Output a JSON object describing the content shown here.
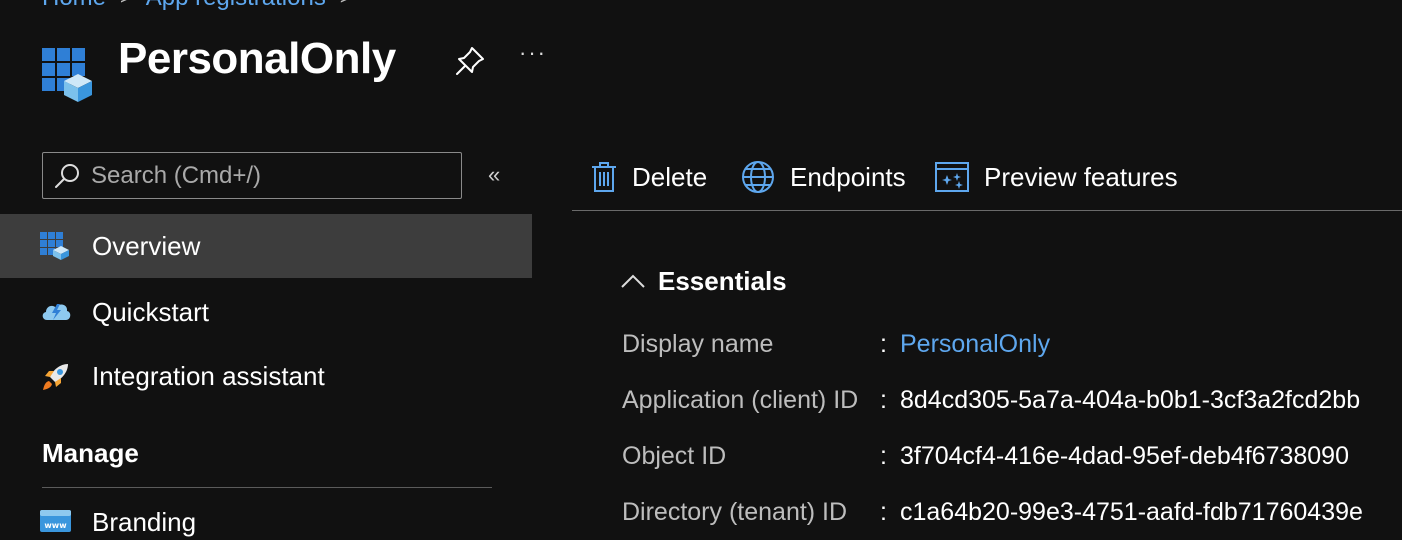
{
  "breadcrumb": [
    {
      "label": "Home"
    },
    {
      "label": "App registrations"
    }
  ],
  "header": {
    "title": "PersonalOnly",
    "more_label": "···"
  },
  "sidebar": {
    "search_placeholder": "Search (Cmd+/)",
    "collapse_label": "«",
    "items": [
      {
        "label": "Overview",
        "icon": "app-grid-icon",
        "active": true
      },
      {
        "label": "Quickstart",
        "icon": "cloud-lightning-icon"
      },
      {
        "label": "Integration assistant",
        "icon": "rocket-icon"
      }
    ],
    "section_manage": "Manage",
    "manage_items": [
      {
        "label": "Branding",
        "icon": "www-browser-icon"
      }
    ]
  },
  "commandbar": {
    "delete_label": "Delete",
    "endpoints_label": "Endpoints",
    "preview_label": "Preview features"
  },
  "essentials": {
    "title": "Essentials",
    "rows": [
      {
        "label": "Display name",
        "value": "PersonalOnly"
      },
      {
        "label": "Application (client) ID",
        "value": "8d4cd305-5a7a-404a-b0b1-3cf3a2fcd2bb"
      },
      {
        "label": "Object ID",
        "value": "3f704cf4-416e-4dad-95ef-deb4f6738090"
      },
      {
        "label": "Directory (tenant) ID",
        "value": "c1a64b20-99e3-4751-aafd-fdb71760439e"
      }
    ],
    "separator": ":"
  },
  "colors": {
    "background": "#111111",
    "link": "#5ea7ee",
    "active_row": "#3d3d3d",
    "icon_blue": "#3a96dd"
  }
}
